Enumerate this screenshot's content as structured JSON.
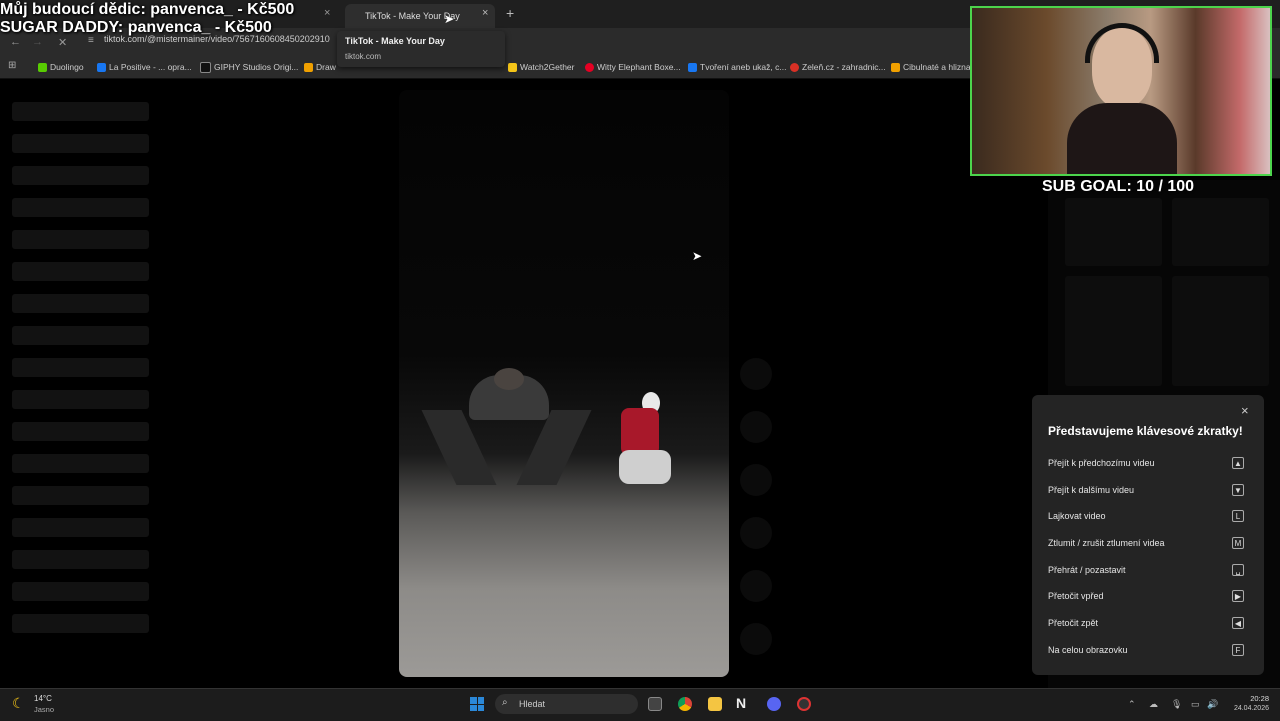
{
  "browser": {
    "tabs": [
      {
        "label": "TikTok - Make Your Day",
        "active": true
      }
    ],
    "new_tab_label": "+",
    "close_glyph": "×",
    "url": "tiktok.com/@mistermainer/video/7567160608450202910",
    "tooltip": {
      "title": "TikTok - Make Your Day",
      "domain": "tiktok.com"
    },
    "bookmarks": [
      {
        "label": "Duolingo",
        "color": "#58cc02"
      },
      {
        "label": "La Positive - ... opra...",
        "color": "#1877f2"
      },
      {
        "label": "GIPHY Studios Origi...",
        "color": "#111111"
      },
      {
        "label": "Draw",
        "color": "#f0a000"
      },
      {
        "label": "Watch2Gether",
        "color": "#f5c518"
      },
      {
        "label": "Witty Elephant Boxe...",
        "color": "#e60023"
      },
      {
        "label": "Tvoření aneb ukaž, c...",
        "color": "#1877f2"
      },
      {
        "label": "Zeleň.cz - zahradnic...",
        "color": "#d93025"
      },
      {
        "label": "Cibulnaté a hliznat...",
        "color": "#f0a000"
      }
    ]
  },
  "overlay": {
    "donations": [
      "Můj budoucí dědic: panvenca_ - Kč500",
      "SUGAR DADDY: panvenca_ - Kč500"
    ],
    "sub_goal": "SUB GOAL: 10 / 100"
  },
  "shortcuts_panel": {
    "title": "Představujeme klávesové zkratky!",
    "close_glyph": "×",
    "items": [
      {
        "label": "Přejít k předchozímu videu",
        "key": "▲"
      },
      {
        "label": "Přejít k dalšímu videu",
        "key": "▼"
      },
      {
        "label": "Lajkovat video",
        "key": "L"
      },
      {
        "label": "Ztlumit / zrušit ztlumení videa",
        "key": "M"
      },
      {
        "label": "Přehrát / pozastavit",
        "key": "␣"
      },
      {
        "label": "Přetočit vpřed",
        "key": "▶"
      },
      {
        "label": "Přetočit zpět",
        "key": "◀"
      },
      {
        "label": "Na celou obrazovku",
        "key": "F"
      }
    ]
  },
  "taskbar": {
    "weather_temp": "14°C",
    "weather_desc": "Jasno",
    "search_placeholder": "Hledat",
    "time": "20:28",
    "date": "24.04.2026",
    "start_color": "#2b88d8"
  }
}
